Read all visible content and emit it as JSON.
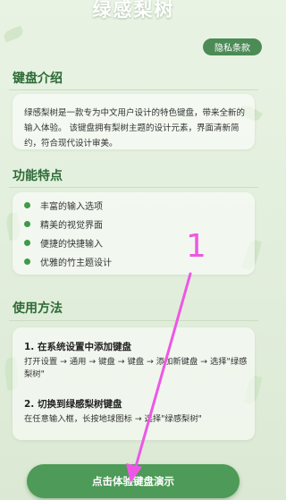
{
  "app": {
    "title": "绿感梨树"
  },
  "header": {
    "privacy_label": "隐私条款"
  },
  "intro": {
    "title": "键盘介绍",
    "text": "绿感梨树是一款专为中文用户设计的特色键盘，带来全新的输入体验。 该键盘拥有梨树主题的设计元素，界面清新简约，符合现代设计审美。"
  },
  "features": {
    "title": "功能特点",
    "items": [
      {
        "label": "丰富的输入选项"
      },
      {
        "label": "精美的视觉界面"
      },
      {
        "label": "便捷的快捷输入"
      },
      {
        "label": "优雅的竹主题设计"
      }
    ]
  },
  "usage": {
    "title": "使用方法",
    "steps": [
      {
        "title": "1. 在系统设置中添加键盘",
        "desc": "打开设置 → 通用 → 键盘 → 键盘 → 添加新键盘 → 选择\"绿感梨树\""
      },
      {
        "title": "2. 切换到绿感梨树键盘",
        "desc": "在任意输入框，长按地球图标 → 选择\"绿感梨树\""
      }
    ]
  },
  "cta": {
    "label": "点击体验键盘演示"
  },
  "annotation": {
    "number": "1",
    "color": "#ee57e6"
  },
  "colors": {
    "accent": "#4e9a58",
    "title": "#2d6b36",
    "dot": "#3e9a4a"
  }
}
